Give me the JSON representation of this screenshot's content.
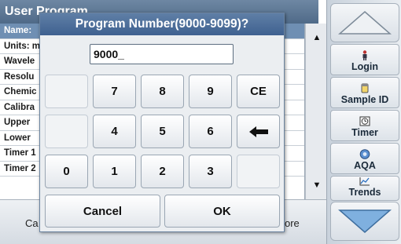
{
  "background": {
    "title": "User Program",
    "rows": [
      "Name:",
      "Units: m",
      "Wavele",
      "Resolu",
      "Chemic",
      "Calibra",
      "Upper",
      "Lower",
      "Timer 1",
      "Timer 2"
    ],
    "bottom_left": "Ca",
    "bottom_right": "ore"
  },
  "sidebar": {
    "login": "Login",
    "sample_id": "Sample ID",
    "timer": "Timer",
    "aqa": "AQA",
    "trends": "Trends"
  },
  "dialog": {
    "title": "Program Number(9000-9099)?",
    "input_value": "9000_",
    "keys": {
      "k7": "7",
      "k8": "8",
      "k9": "9",
      "ce": "CE",
      "k4": "4",
      "k5": "5",
      "k6": "6",
      "k0": "0",
      "k1": "1",
      "k2": "2",
      "k3": "3"
    },
    "cancel": "Cancel",
    "ok": "OK"
  },
  "colors": {
    "title_bar": "#4f6a88",
    "dialog_title": "#3f6190",
    "selected_row": "#6f8fb3",
    "nav_arrow": "#6f9fcf"
  }
}
